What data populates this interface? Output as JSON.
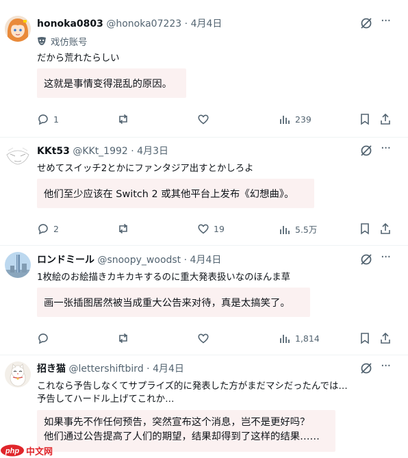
{
  "tweets": [
    {
      "name": "honoka0803",
      "handle": "@honoka07223",
      "date": "4月4日",
      "label": "戏仿账号",
      "lines": [
        "だから荒れたらしい"
      ],
      "translation": [
        "这就是事情变得混乱的原因。"
      ],
      "reply_count": "1",
      "retweet_count": "",
      "like_count": "",
      "view_count": "239"
    },
    {
      "name": "KKt53",
      "handle": "@KKt_1992",
      "date": "4月3日",
      "lines": [
        "せめてスイッチ2とかにファンタジア出すとかしろよ"
      ],
      "translation": [
        "他们至少应该在 Switch 2 或其他平台上发布《幻想曲》。"
      ],
      "reply_count": "2",
      "retweet_count": "",
      "like_count": "19",
      "view_count": "5.5万"
    },
    {
      "name": "ロンドミール",
      "handle": "@snoopy_woodst",
      "date": "4月4日",
      "lines": [
        "1枚絵のお絵描きカキカキするのに重大発表扱いなのほんま草"
      ],
      "translation": [
        "画一张插图居然被当成重大公告来对待，真是太搞笑了。"
      ],
      "reply_count": "",
      "retweet_count": "",
      "like_count": "",
      "view_count": "1,814"
    },
    {
      "name": "招き猫",
      "handle": "@lettershiftbird",
      "date": "4月4日",
      "lines": [
        "これなら予告しなくてサプライズ的に発表した方がまだマシだったんでは…",
        "予告してハードル上げてこれか…"
      ],
      "translation": [
        "如果事先不作任何预告，突然宣布这个消息，岂不是更好吗？",
        "他们通过公告提高了人们的期望，结果却得到了这样的结果……"
      ]
    }
  ],
  "separator": "·",
  "watermark": {
    "logo": "php",
    "text": "中文网"
  },
  "colors": {
    "text": "#0f1419",
    "muted": "#536471",
    "translation_bg": "#fbf1f1",
    "watermark": "#e0262b"
  },
  "icons": [
    "reply-icon",
    "retweet-icon",
    "like-icon",
    "views-icon",
    "bookmark-icon",
    "share-icon",
    "grok-icon",
    "more-icon",
    "parody-mask-icon"
  ]
}
